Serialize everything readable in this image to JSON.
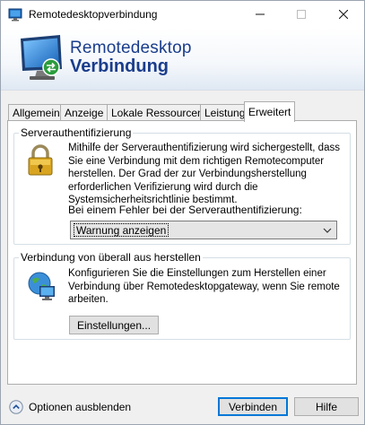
{
  "window": {
    "title": "Remotedesktopverbindung"
  },
  "banner": {
    "line1": "Remotedesktop",
    "line2": "Verbindung"
  },
  "tabs": [
    {
      "label": "Allgemein",
      "active": false
    },
    {
      "label": "Anzeige",
      "active": false
    },
    {
      "label": "Lokale Ressourcen",
      "active": false
    },
    {
      "label": "Leistung",
      "active": false
    },
    {
      "label": "Erweitert",
      "active": true
    }
  ],
  "server_auth": {
    "legend": "Serverauthentifizierung",
    "description": "Mithilfe der Serverauthentifizierung wird sichergestellt, dass Sie eine Verbindung mit dem richtigen Remotecomputer herstellen. Der Grad der zur Verbindungsherstellung erforderlichen Verifizierung wird durch die Systemsicherheitsrichtlinie bestimmt.",
    "error_label": "Bei einem Fehler bei der Serverauthentifizierung:",
    "error_select_value": "Warnung anzeigen"
  },
  "anywhere": {
    "legend": "Verbindung von überall aus herstellen",
    "description": "Konfigurieren Sie die Einstellungen zum Herstellen einer Verbindung über Remotedesktopgateway, wenn Sie remote arbeiten.",
    "settings_button": "Einstellungen..."
  },
  "footer": {
    "options_label": "Optionen ausblenden",
    "connect_button": "Verbinden",
    "help_button": "Hilfe"
  },
  "colors": {
    "accent": "#0078d7",
    "banner_text": "#1a3d8c"
  }
}
